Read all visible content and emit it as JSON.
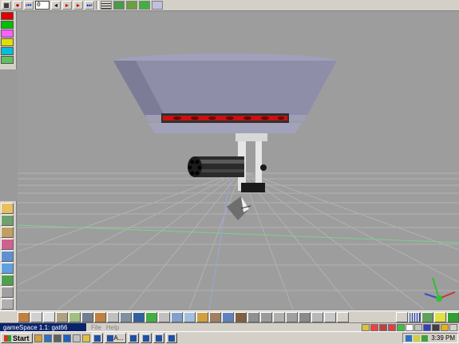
{
  "top_toolbar": {
    "frame_value": "0",
    "buttons": [
      "record",
      "go-to-start",
      "step-back",
      "play",
      "step-forward",
      "go-to-end"
    ]
  },
  "palette_colors": [
    "#e00000",
    "#00c000",
    "#ff60ff",
    "#e0e000",
    "#00c0e0",
    "#60c060"
  ],
  "status": {
    "app_title": "gameSpace 1.1: gat66",
    "menu_file": "File",
    "menu_help": "Help"
  },
  "taskbar": {
    "start_label": "Start",
    "task_label": "A...",
    "clock": "3:39 PM"
  },
  "colors": {
    "viewport_bg": "#9d9d9d",
    "grid": "#b8b8b8",
    "bowl": "#8e8ea8",
    "ring_accent": "#cc1010",
    "chrome": "#d4d0c8"
  },
  "icons": {
    "axis_gizmo": "xyz-axis-gizmo-icon",
    "start_logo": "windows-flag-icon"
  }
}
